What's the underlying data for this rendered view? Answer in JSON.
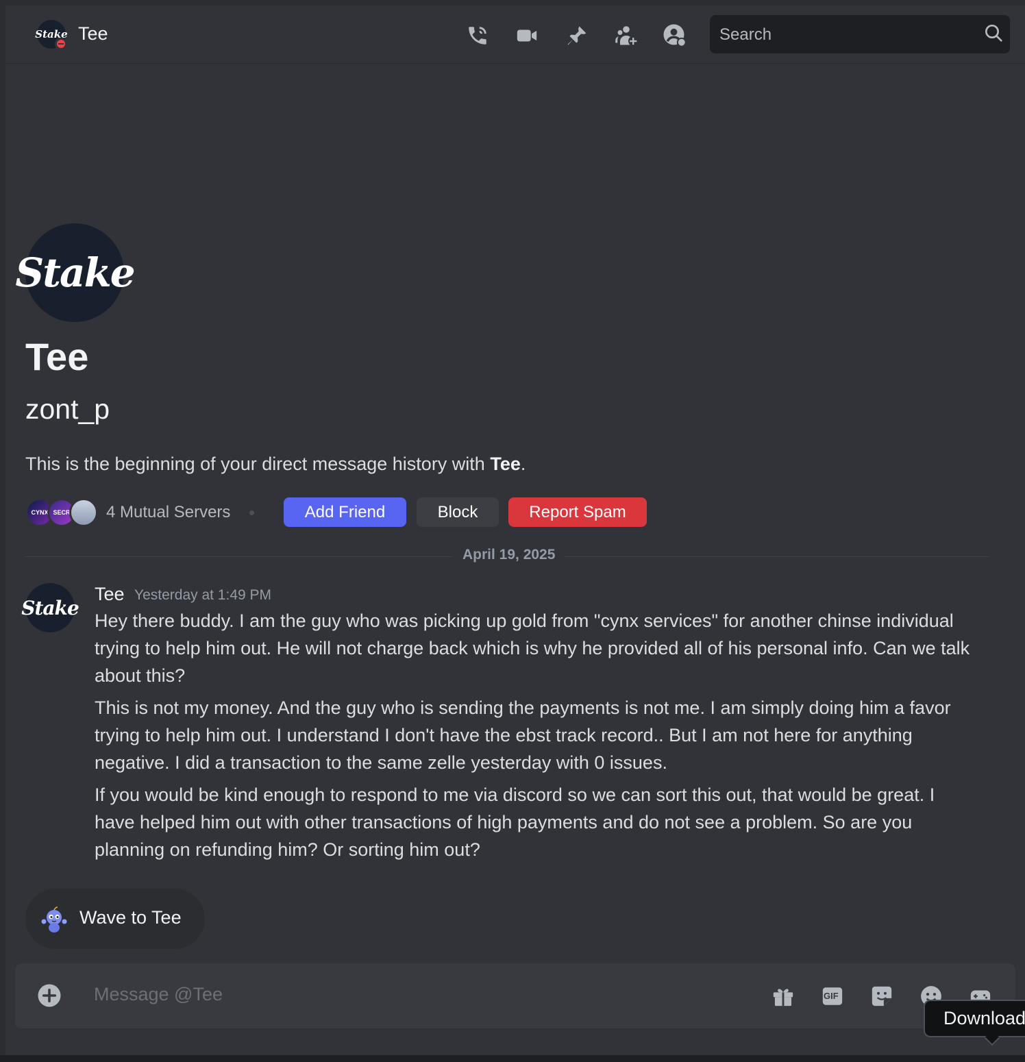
{
  "header": {
    "avatar_text": "Stake",
    "title": "Tee",
    "search_placeholder": "Search",
    "icons": [
      "phone-call-icon",
      "video-call-icon",
      "pinned-messages-icon",
      "add-friends-to-dm-icon",
      "user-profile-icon",
      "search-icon"
    ]
  },
  "profile": {
    "avatar_text": "Stake",
    "display_name": "Tee",
    "username": "zont_p",
    "intro_prefix": "This is the beginning of your direct message history with ",
    "intro_name": "Tee",
    "intro_suffix": ".",
    "mutual_servers": "4 Mutual Servers",
    "mutual_avatar_labels": [
      "CYNX",
      "SECR",
      ""
    ],
    "buttons": {
      "add_friend": "Add Friend",
      "block": "Block",
      "report_spam": "Report Spam"
    }
  },
  "divider_date": "April 19, 2025",
  "message": {
    "avatar_text": "Stake",
    "author": "Tee",
    "timestamp": "Yesterday at 1:49 PM",
    "paragraphs": [
      "Hey there buddy. I am the guy who was picking up gold from \"cynx services\" for another chinse individual trying to help him out. He will not charge back which is why he provided all of his personal info. Can we talk about this?",
      "This is not my money. And the guy who is sending the payments is not me. I am simply doing him a favor trying to help him out. I understand I don't have the ebst track record.. But I am not here for anything negative. I did a transaction to the same zelle yesterday with 0 issues.",
      "If you would be kind enough to respond to me via discord so we can sort this out, that would be great. I have helped him out with other transactions of high payments and do not see a problem. So are you planning on refunding him? Or sorting him out?"
    ]
  },
  "wave_button": "Wave to Tee",
  "composer": {
    "placeholder": "Message @Tee",
    "gif_label": "GIF"
  },
  "tooltip": "Download",
  "colors": {
    "background": "#323338",
    "blurple": "#5865f2",
    "danger": "#da373c",
    "dnd_status": "#f23f43"
  }
}
